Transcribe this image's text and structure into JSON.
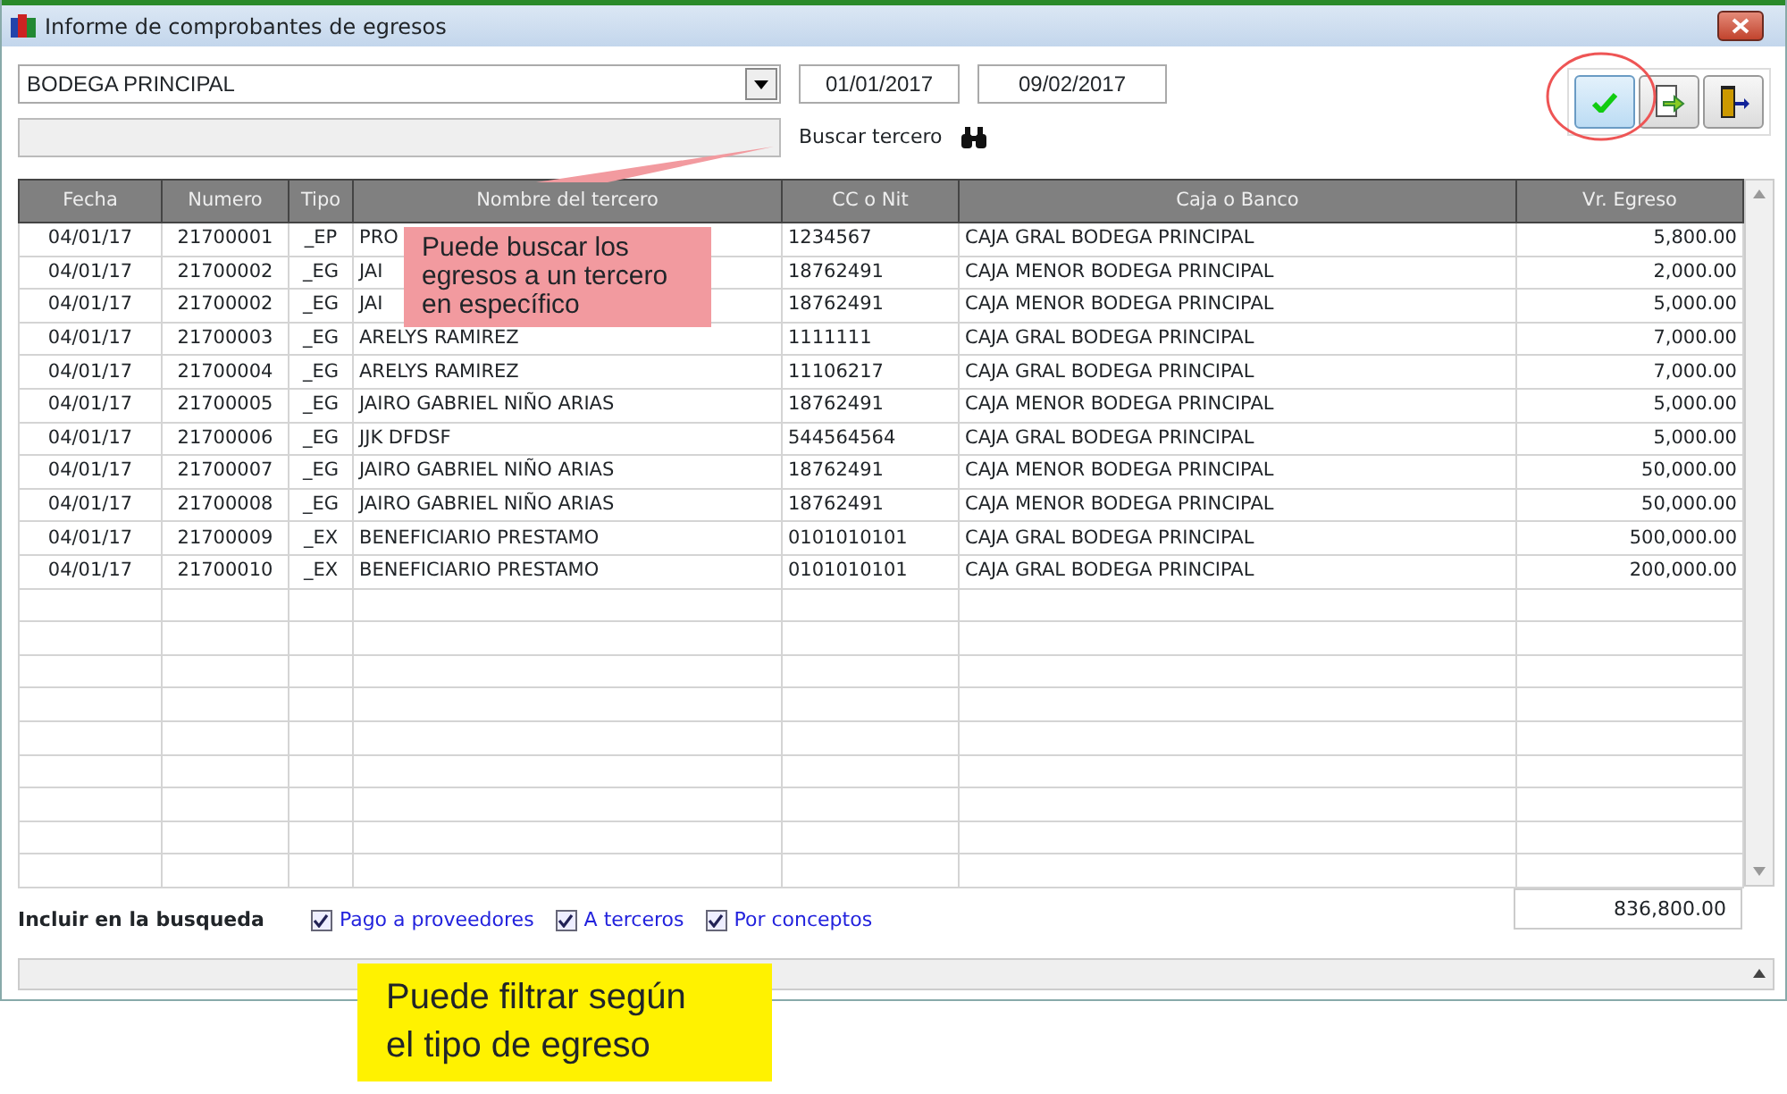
{
  "window": {
    "title": "Informe de comprobantes de egresos"
  },
  "filters": {
    "warehouse": "BODEGA PRINCIPAL",
    "date_from": "01/01/2017",
    "date_to": "09/02/2017",
    "search_label": "Buscar tercero"
  },
  "table": {
    "columns": [
      "Fecha",
      "Numero",
      "Tipo",
      "Nombre del tercero",
      "CC o Nit",
      "Caja o Banco",
      "Vr. Egreso"
    ],
    "rows": [
      [
        "04/01/17",
        "21700001",
        "_EP",
        "PRO",
        "1234567",
        "CAJA GRAL BODEGA PRINCIPAL",
        "5,800.00"
      ],
      [
        "04/01/17",
        "21700002",
        "_EG",
        "JAI",
        "18762491",
        "CAJA MENOR BODEGA PRINCIPAL",
        "2,000.00"
      ],
      [
        "04/01/17",
        "21700002",
        "_EG",
        "JAI",
        "18762491",
        "CAJA MENOR BODEGA PRINCIPAL",
        "5,000.00"
      ],
      [
        "04/01/17",
        "21700003",
        "_EG",
        "ARELYS RAMIREZ",
        "1111111",
        "CAJA GRAL BODEGA PRINCIPAL",
        "7,000.00"
      ],
      [
        "04/01/17",
        "21700004",
        "_EG",
        "ARELYS RAMIREZ",
        "11106217",
        "CAJA GRAL BODEGA PRINCIPAL",
        "7,000.00"
      ],
      [
        "04/01/17",
        "21700005",
        "_EG",
        "JAIRO GABRIEL NIÑO ARIAS",
        "18762491",
        "CAJA MENOR BODEGA PRINCIPAL",
        "5,000.00"
      ],
      [
        "04/01/17",
        "21700006",
        "_EG",
        "JJK DFDSF",
        "544564564",
        "CAJA GRAL BODEGA PRINCIPAL",
        "5,000.00"
      ],
      [
        "04/01/17",
        "21700007",
        "_EG",
        "JAIRO GABRIEL NIÑO ARIAS",
        "18762491",
        "CAJA MENOR BODEGA PRINCIPAL",
        "50,000.00"
      ],
      [
        "04/01/17",
        "21700008",
        "_EG",
        "JAIRO GABRIEL NIÑO ARIAS",
        "18762491",
        "CAJA MENOR BODEGA PRINCIPAL",
        "50,000.00"
      ],
      [
        "04/01/17",
        "21700009",
        "_EX",
        "BENEFICIARIO PRESTAMO",
        "0101010101",
        "CAJA GRAL BODEGA PRINCIPAL",
        "500,000.00"
      ],
      [
        "04/01/17",
        "21700010",
        "_EX",
        "BENEFICIARIO PRESTAMO",
        "0101010101",
        "CAJA GRAL BODEGA PRINCIPAL",
        "200,000.00"
      ]
    ],
    "total": "836,800.00"
  },
  "include": {
    "label": "Incluir en la busqueda",
    "options": [
      {
        "label": "Pago a proveedores",
        "checked": true
      },
      {
        "label": "A terceros",
        "checked": true
      },
      {
        "label": "Por conceptos",
        "checked": true
      }
    ]
  },
  "callouts": [
    {
      "kind": "pink",
      "text": "Puede buscar los egresos a un tercero en específico"
    },
    {
      "kind": "yellow",
      "text": "Puede filtrar según el tipo de egreso"
    }
  ]
}
